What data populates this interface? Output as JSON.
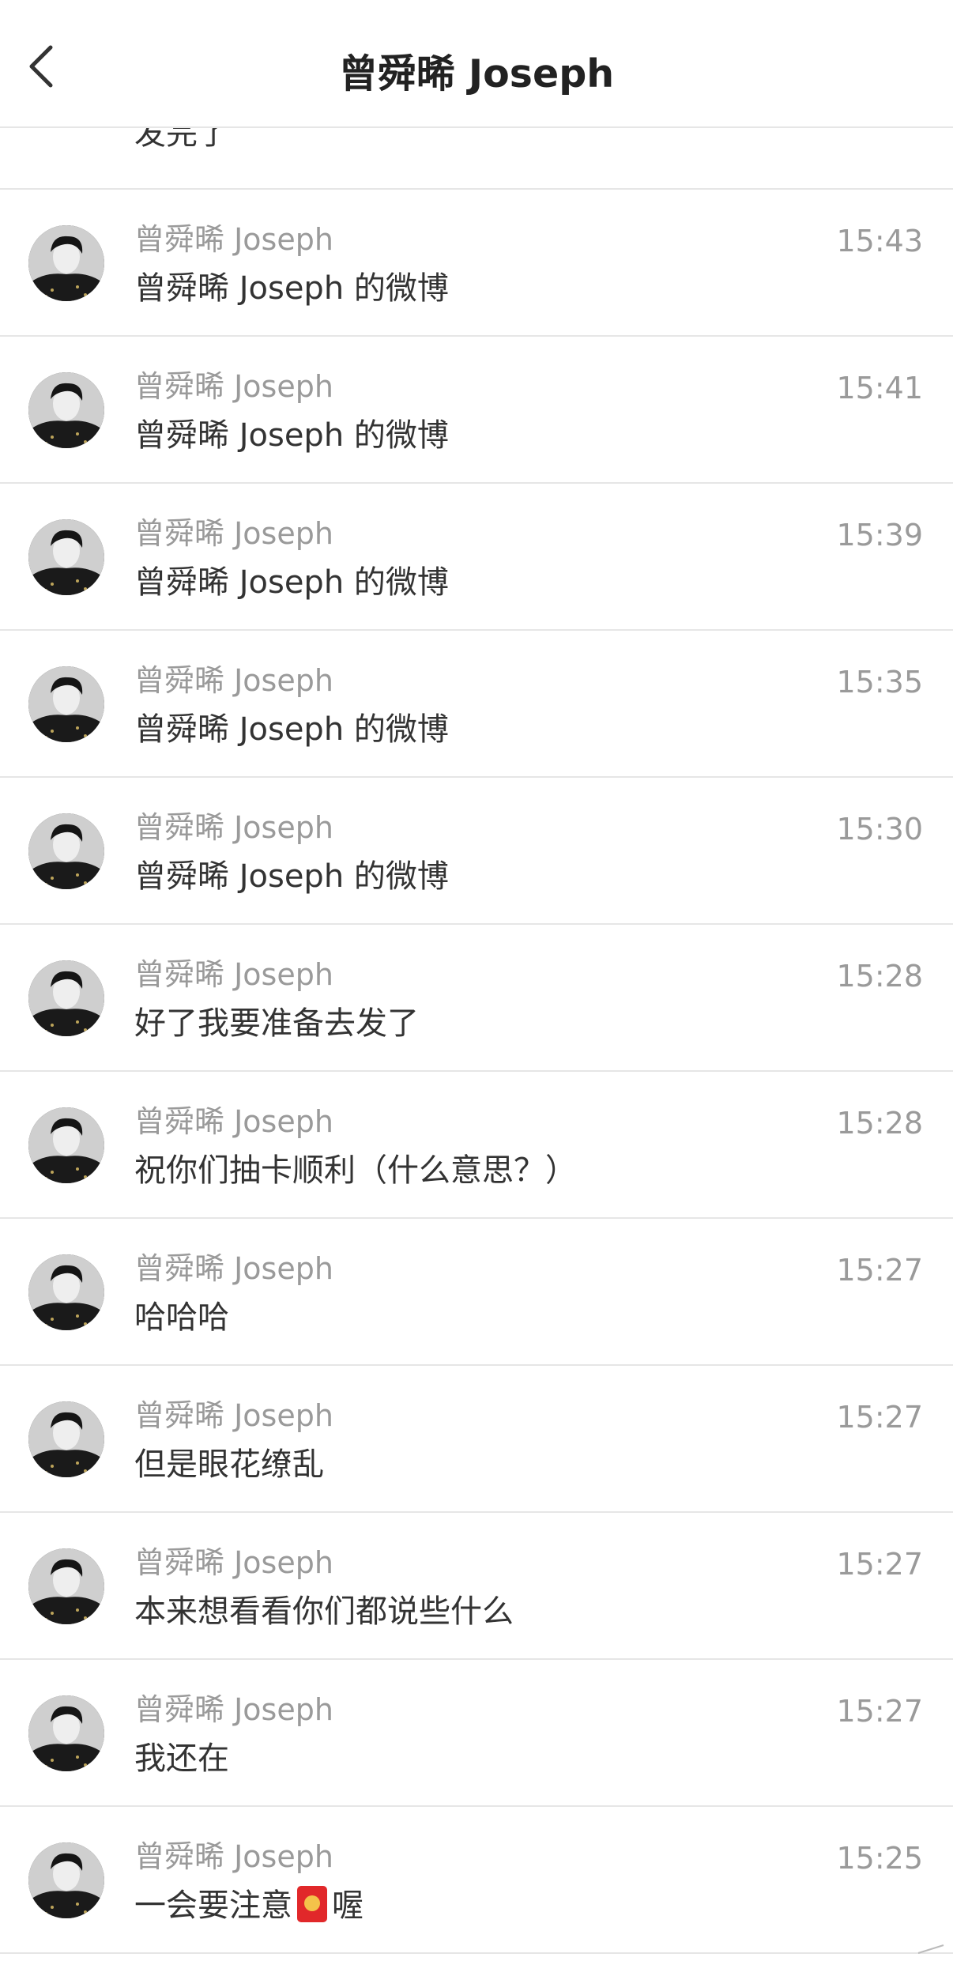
{
  "header": {
    "title": "曾舜晞 Joseph"
  },
  "partial_row": {
    "message": "发完了"
  },
  "messages": [
    {
      "sender": "曾舜晞 Joseph",
      "text": "曾舜晞 Joseph 的微博",
      "time": "15:43"
    },
    {
      "sender": "曾舜晞 Joseph",
      "text": "曾舜晞 Joseph 的微博",
      "time": "15:41"
    },
    {
      "sender": "曾舜晞 Joseph",
      "text": "曾舜晞 Joseph 的微博",
      "time": "15:39"
    },
    {
      "sender": "曾舜晞 Joseph",
      "text": "曾舜晞 Joseph 的微博",
      "time": "15:35"
    },
    {
      "sender": "曾舜晞 Joseph",
      "text": "曾舜晞 Joseph 的微博",
      "time": "15:30"
    },
    {
      "sender": "曾舜晞 Joseph",
      "text": "好了我要准备去发了",
      "time": "15:28"
    },
    {
      "sender": "曾舜晞 Joseph",
      "text": "祝你们抽卡顺利（什么意思？）",
      "time": "15:28"
    },
    {
      "sender": "曾舜晞 Joseph",
      "text": "哈哈哈",
      "time": "15:27"
    },
    {
      "sender": "曾舜晞 Joseph",
      "text": "但是眼花缭乱",
      "time": "15:27"
    },
    {
      "sender": "曾舜晞 Joseph",
      "text": "本来想看看你们都说些什么",
      "time": "15:27"
    },
    {
      "sender": "曾舜晞 Joseph",
      "text": "我还在",
      "time": "15:27"
    },
    {
      "sender": "曾舜晞 Joseph",
      "text_before": "一会要注意",
      "text_after": "喔",
      "time": "15:25"
    }
  ],
  "icons": {
    "back": "chevron-left-icon",
    "red_packet": "red-envelope-icon",
    "avatar": "avatar-photo"
  },
  "colors": {
    "title": "#222222",
    "sender": "#9a9a9a",
    "message": "#333333",
    "divider": "#e6e6e6",
    "red_packet": "#e1282a"
  }
}
